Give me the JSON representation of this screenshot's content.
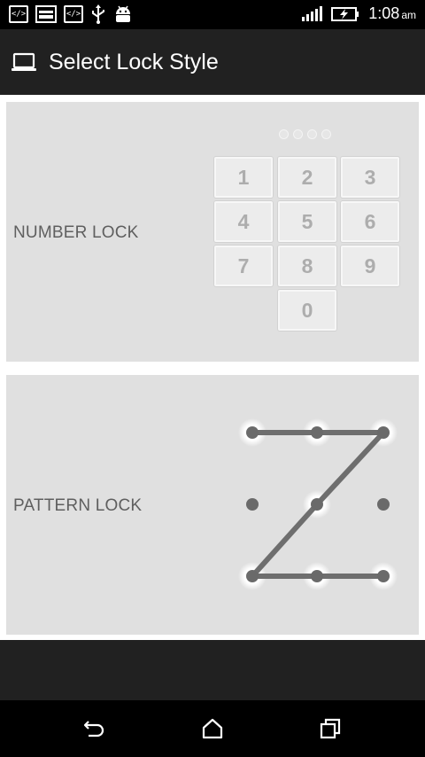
{
  "status_bar": {
    "time": "1:08",
    "ampm": "am",
    "notification_icons": [
      "code-icon",
      "image-icon",
      "code-icon",
      "usb-icon",
      "android-icon"
    ],
    "system_icons": [
      "signal-icon",
      "battery-charging-icon"
    ]
  },
  "action_bar": {
    "icon": "laptop-icon",
    "title": "Select Lock Style"
  },
  "options": {
    "number_lock": {
      "label": "NUMBER LOCK",
      "keys": [
        "1",
        "2",
        "3",
        "4",
        "5",
        "6",
        "7",
        "8",
        "9",
        "0"
      ],
      "pin_dots": 4
    },
    "pattern_lock": {
      "label": "PATTERN LOCK",
      "grid": "3x3",
      "pattern_sequence": [
        1,
        2,
        3,
        5,
        7,
        8,
        9
      ]
    }
  },
  "nav_bar": {
    "buttons": [
      "back-icon",
      "home-icon",
      "recent-apps-icon"
    ]
  }
}
